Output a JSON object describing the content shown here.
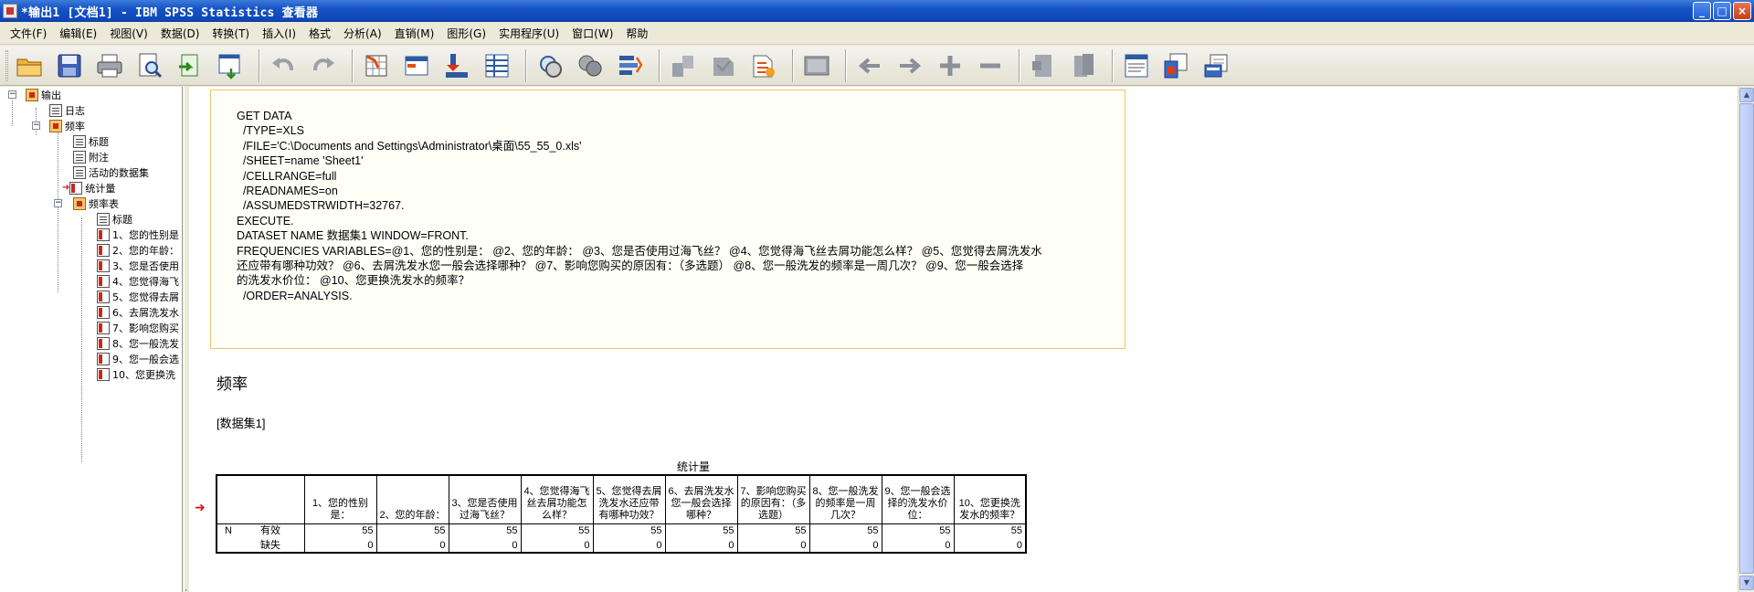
{
  "window": {
    "title": "*输出1 [文档1] - IBM SPSS Statistics 查看器",
    "minimize": "_",
    "maximize": "□",
    "close": "×"
  },
  "menu": [
    "文件(F)",
    "编辑(E)",
    "视图(V)",
    "数据(D)",
    "转换(T)",
    "插入(I)",
    "格式",
    "分析(A)",
    "直销(M)",
    "图形(G)",
    "实用程序(U)",
    "窗口(W)",
    "帮助"
  ],
  "toolbar_icons": [
    "open-icon",
    "save-icon",
    "print-icon",
    "print-preview-icon",
    "export-icon",
    "recall-dialog-icon",
    "undo-icon",
    "redo-icon",
    "goto-data-icon",
    "goto-case-icon",
    "goto-variable-icon",
    "variables-icon",
    "use-sets-icon",
    "show-all-variables-icon",
    "spelling-icon",
    "promote-icon",
    "demote-icon",
    "expand-icon",
    "collapse-icon",
    "show-icon",
    "hide-icon",
    "insert-heading-icon",
    "insert-title-icon",
    "insert-text-icon"
  ],
  "tree": {
    "root": "输出",
    "log": "日志",
    "freq": "频率",
    "title": "标题",
    "notes": "附注",
    "active_dataset": "活动的数据集",
    "stats": "统计量",
    "freq_table": "频率表",
    "sub_title": "标题",
    "items": [
      "1、您的性别是",
      "2、您的年龄：",
      "3、您是否使用",
      "4、您觉得海飞",
      "5、您觉得去屑",
      "6、去屑洗发水",
      "7、影响您购买",
      "8、您一般洗发",
      "9、您一般会选",
      "10、您更换洗"
    ]
  },
  "syntax": [
    "GET DATA",
    "  /TYPE=XLS",
    "  /FILE='C:\\Documents and Settings\\Administrator\\桌面\\55_55_0.xls'",
    "  /SHEET=name 'Sheet1'",
    "  /CELLRANGE=full",
    "  /READNAMES=on",
    "  /ASSUMEDSTRWIDTH=32767.",
    "EXECUTE.",
    "DATASET NAME 数据集1 WINDOW=FRONT.",
    "FREQUENCIES VARIABLES=@1、您的性别是： @2、您的年龄： @3、您是否使用过海飞丝？ @4、您觉得海飞丝去屑功能怎么样？ @5、您觉得去屑洗发水",
    "还应带有哪种功效？ @6、去屑洗发水您一般会选择哪种？ @7、影响您购买的原因有：（多选题） @8、您一般洗发的频率是一周几次？ @9、您一般会选择",
    "的洗发水价位： @10、您更换洗发水的频率？",
    "  /ORDER=ANALYSIS."
  ],
  "section_title": "频率",
  "dataset_label": "[数据集1]",
  "stats_table": {
    "title": "统计量",
    "columns": [
      "1、您的性别是：",
      "2、您的年龄：",
      "3、您是否使用过海飞丝？",
      "4、您觉得海飞丝去屑功能怎么样？",
      "5、您觉得去屑洗发水还应带有哪种功效？",
      "6、去屑洗发水您一般会选择哪种？",
      "7、影响您购买的原因有：（多选题）",
      "8、您一般洗发的频率是一周几次？",
      "9、您一般会选择的洗发水价位：",
      "10、您更换洗发水的频率？"
    ],
    "stub_n": "N",
    "row_valid": {
      "label": "有效",
      "values": [
        "55",
        "55",
        "55",
        "55",
        "55",
        "55",
        "55",
        "55",
        "55",
        "55"
      ]
    },
    "row_missing": {
      "label": "缺失",
      "values": [
        "0",
        "0",
        "0",
        "0",
        "0",
        "0",
        "0",
        "0",
        "0",
        "0"
      ]
    }
  },
  "colors": {
    "titlebar": "#0f47b6",
    "syntax_border": "#f0c36c",
    "arrow": "#e01010"
  }
}
